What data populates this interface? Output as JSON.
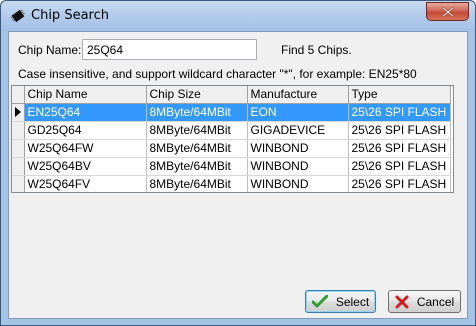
{
  "window": {
    "title": "Chip Search",
    "icon": "chip-icon",
    "close_icon": "close-icon"
  },
  "search": {
    "label": "Chip Name:",
    "value": "25Q64",
    "found_text": "Find 5 Chips.",
    "hint": "Case insensitive, and support wildcard character \"*\", for example: EN25*80"
  },
  "grid": {
    "columns": [
      "Chip Name",
      "Chip Size",
      "Manufacture",
      "Type"
    ],
    "selected_index": 0,
    "rows": [
      {
        "name": "EN25Q64",
        "size": "8MByte/64MBit",
        "manufacture": "EON",
        "type": "25\\26 SPI FLASH"
      },
      {
        "name": "GD25Q64",
        "size": "8MByte/64MBit",
        "manufacture": "GIGADEVICE",
        "type": "25\\26 SPI FLASH"
      },
      {
        "name": "W25Q64FW",
        "size": "8MByte/64MBit",
        "manufacture": "WINBOND",
        "type": "25\\26 SPI FLASH"
      },
      {
        "name": "W25Q64BV",
        "size": "8MByte/64MBit",
        "manufacture": "WINBOND",
        "type": "25\\26 SPI FLASH"
      },
      {
        "name": "W25Q64FV",
        "size": "8MByte/64MBit",
        "manufacture": "WINBOND",
        "type": "25\\26 SPI FLASH"
      }
    ]
  },
  "buttons": {
    "select_label": "Select",
    "cancel_label": "Cancel",
    "select_icon": "checkmark-icon",
    "cancel_icon": "x-mark-icon"
  },
  "colors": {
    "selection": "#3399ff",
    "select_check": "#2f9e2f",
    "cancel_x": "#d11d1d"
  }
}
